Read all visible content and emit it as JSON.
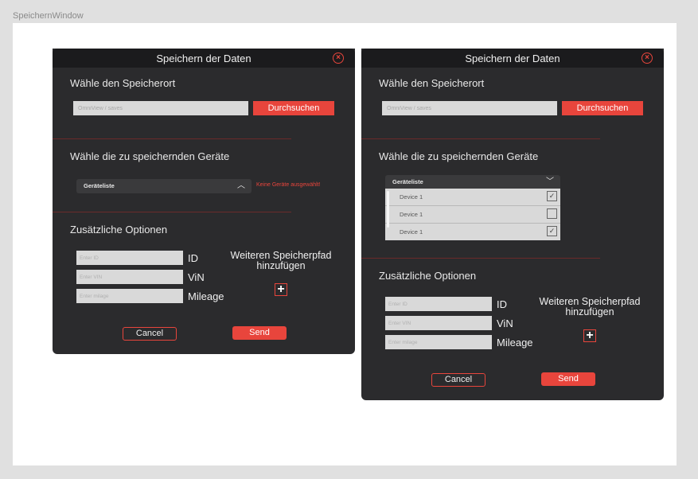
{
  "frame_label": "SpeichernWindow",
  "colors": {
    "accent": "#e8453c",
    "dialog_bg": "#2b2b2d",
    "titlebar_bg": "#1b1b1d",
    "input_bg": "#d9d9d9"
  },
  "dialogs": [
    {
      "title": "Speichern der Daten",
      "close_icon": "⊗",
      "location_heading": "Wähle den Speicherort",
      "path_placeholder": "OmniView / saves",
      "browse_label": "Durchsuchen",
      "devices_heading": "Wähle die zu speichernden Geräte",
      "device_list_label": "Geräteliste",
      "device_list_state": "collapsed",
      "chevron": "︿",
      "error_text": "Keine Geräte ausgewählt!",
      "options_heading": "Zusätzliche Optionen",
      "id_placeholder": "Enter ID",
      "id_label": "ID",
      "vin_placeholder": "Enter VIN",
      "vin_label": "ViN",
      "mileage_placeholder": "Enter milage",
      "mileage_label": "Mileage",
      "extra_path_line1": "Weiteren Speicherpfad",
      "extra_path_line2": "hinzufügen",
      "plus_icon": "+",
      "cancel_label": "Cancel",
      "send_label": "Send"
    },
    {
      "title": "Speichern der Daten",
      "close_icon": "⊗",
      "location_heading": "Wähle den Speicherort",
      "path_placeholder": "OmniView / saves",
      "browse_label": "Durchsuchen",
      "devices_heading": "Wähle die zu speichernden Geräte",
      "device_list_label": "Geräteliste",
      "device_list_state": "expanded",
      "chevron": "﹀",
      "devices": [
        {
          "name": "Device 1",
          "checked": true,
          "mark": "✓"
        },
        {
          "name": "Device 1",
          "checked": false,
          "mark": ""
        },
        {
          "name": "Device 1",
          "checked": true,
          "mark": "✓"
        }
      ],
      "options_heading": "Zusätzliche Optionen",
      "id_placeholder": "Enter ID",
      "id_label": "ID",
      "vin_placeholder": "Enter VIN",
      "vin_label": "ViN",
      "mileage_placeholder": "Enter milage",
      "mileage_label": "Mileage",
      "extra_path_line1": "Weiteren Speicherpfad",
      "extra_path_line2": "hinzufügen",
      "plus_icon": "+",
      "cancel_label": "Cancel",
      "send_label": "Send"
    }
  ]
}
